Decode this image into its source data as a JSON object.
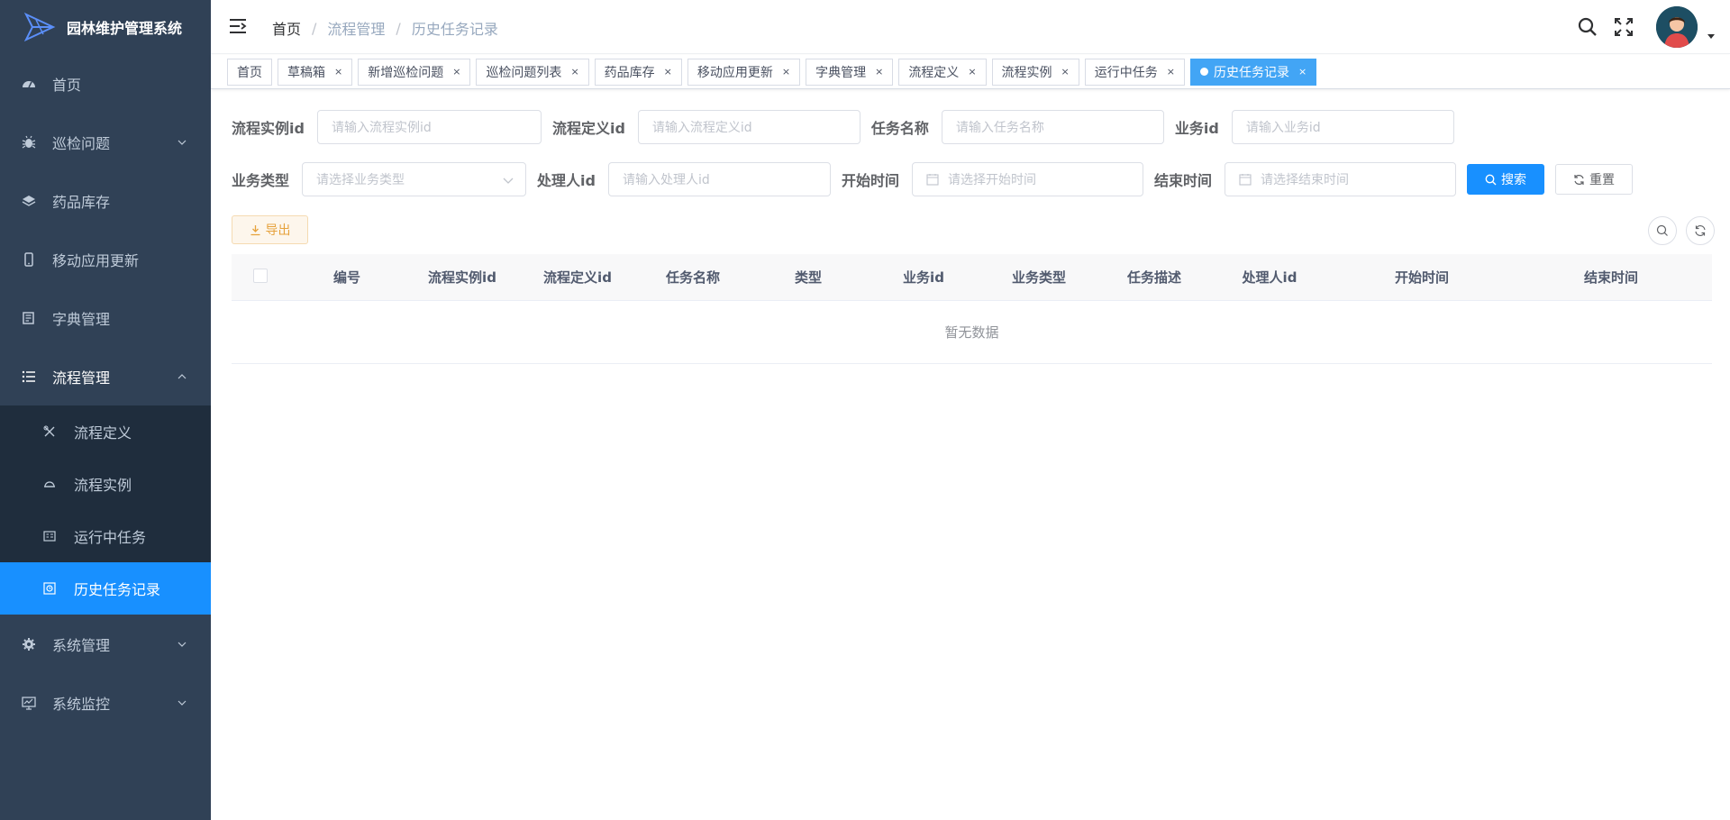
{
  "app": {
    "title": "园林维护管理系统"
  },
  "sidebar": {
    "items": [
      {
        "label": "首页",
        "icon": "dashboard-icon"
      },
      {
        "label": "巡检问题",
        "icon": "bug-icon"
      },
      {
        "label": "药品库存",
        "icon": "layers-icon"
      },
      {
        "label": "移动应用更新",
        "icon": "phone-icon"
      },
      {
        "label": "字典管理",
        "icon": "dict-icon"
      },
      {
        "label": "流程管理",
        "icon": "list-icon"
      },
      {
        "label": "系统管理",
        "icon": "gear-icon"
      },
      {
        "label": "系统监控",
        "icon": "monitor-icon"
      }
    ],
    "sub_items": [
      {
        "label": "流程定义",
        "icon": "tools-icon"
      },
      {
        "label": "流程实例",
        "icon": "instance-icon"
      },
      {
        "label": "运行中任务",
        "icon": "task-icon"
      },
      {
        "label": "历史任务记录",
        "icon": "history-icon"
      }
    ],
    "active_color": "#1890ff",
    "bg_color": "#304156"
  },
  "breadcrumb": {
    "home": "首页",
    "separator": "/",
    "level1": "流程管理",
    "level2": "历史任务记录"
  },
  "tags": [
    {
      "label": "首页"
    },
    {
      "label": "草稿箱",
      "close": "×"
    },
    {
      "label": "新增巡检问题",
      "close": "×"
    },
    {
      "label": "巡检问题列表",
      "close": "×"
    },
    {
      "label": "药品库存",
      "close": "×"
    },
    {
      "label": "移动应用更新",
      "close": "×"
    },
    {
      "label": "字典管理",
      "close": "×"
    },
    {
      "label": "流程定义",
      "close": "×"
    },
    {
      "label": "流程实例",
      "close": "×"
    },
    {
      "label": "运行中任务",
      "close": "×"
    },
    {
      "label": "历史任务记录",
      "close": "×"
    }
  ],
  "form": {
    "proc_inst_label": "流程实例id",
    "proc_inst_placeholder": "请输入流程实例id",
    "proc_def_label": "流程定义id",
    "proc_def_placeholder": "请输入流程定义id",
    "task_name_label": "任务名称",
    "task_name_placeholder": "请输入任务名称",
    "biz_id_label": "业务id",
    "biz_id_placeholder": "请输入业务id",
    "biz_type_label": "业务类型",
    "biz_type_placeholder": "请选择业务类型",
    "handler_label": "处理人id",
    "handler_placeholder": "请输入处理人id",
    "start_label": "开始时间",
    "start_placeholder": "请选择开始时间",
    "end_label": "结束时间",
    "end_placeholder": "请选择结束时间",
    "search_button": "搜索",
    "reset_button": "重置"
  },
  "toolbar": {
    "export_button": "导出"
  },
  "table": {
    "columns": [
      "编号",
      "流程实例id",
      "流程定义id",
      "任务名称",
      "类型",
      "业务id",
      "业务类型",
      "任务描述",
      "处理人id",
      "开始时间",
      "结束时间"
    ],
    "empty_text": "暂无数据"
  }
}
